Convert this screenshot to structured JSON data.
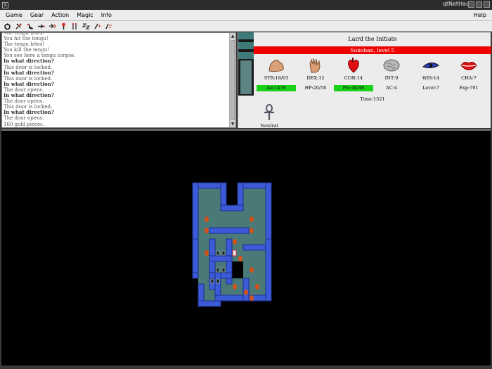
{
  "window": {
    "title": "qtNetHack",
    "close_glyph": "x"
  },
  "menu": {
    "items": [
      "Game",
      "Gear",
      "Action",
      "Magic",
      "Info"
    ],
    "help": "Help"
  },
  "toolbar": {
    "icons": [
      "again-icon",
      "get-icon",
      "kick-icon",
      "throw-icon",
      "fire-icon",
      "drop-icon",
      "eat-icon",
      "rest-icon",
      "cast-icon",
      "search-icon"
    ]
  },
  "messages": [
    {
      "text": "The tengu bites!",
      "bold": false
    },
    {
      "text": "You hit the tengu!",
      "bold": false
    },
    {
      "text": "The tengu bites!",
      "bold": false
    },
    {
      "text": "You kill the tengu!",
      "bold": false
    },
    {
      "text": "You see here a tengu corpse.",
      "bold": false
    },
    {
      "text": "In what direction?",
      "bold": true
    },
    {
      "text": "This door is locked.",
      "bold": false
    },
    {
      "text": "In what direction?",
      "bold": true
    },
    {
      "text": "This door is locked.",
      "bold": false
    },
    {
      "text": "In what direction?",
      "bold": true
    },
    {
      "text": "The door opens.",
      "bold": false
    },
    {
      "text": "In what direction?",
      "bold": true
    },
    {
      "text": "The door opens.",
      "bold": false
    },
    {
      "text": "This door is locked.",
      "bold": false
    },
    {
      "text": "In what direction?",
      "bold": true
    },
    {
      "text": "The door opens.",
      "bold": false
    },
    {
      "text": "160 gold pieces.",
      "bold": false
    }
  ],
  "status": {
    "name": "Laird the Initiate",
    "level_line": "Sokoban, level 5",
    "stats": [
      {
        "label": "STR:18/03",
        "icon": "bicep-icon"
      },
      {
        "label": "DEX:12",
        "icon": "hand-icon"
      },
      {
        "label": "CON:14",
        "icon": "heart-icon"
      },
      {
        "label": "INT:9",
        "icon": "brain-icon"
      },
      {
        "label": "WIS:14",
        "icon": "eye-icon"
      },
      {
        "label": "CHA:7",
        "icon": "lips-icon"
      }
    ],
    "values": [
      {
        "text": "Au:1470",
        "green": true
      },
      {
        "text": "HP:20/50",
        "green": false
      },
      {
        "text": "Pw:40/46",
        "green": true
      },
      {
        "text": "AC:4",
        "green": false
      },
      {
        "text": "Level:7",
        "green": false
      },
      {
        "text": "Exp:791",
        "green": false
      }
    ],
    "time": "Time:1521",
    "alignment": "Neutral"
  },
  "colors": {
    "floor": "#4a7a78",
    "wall": "#3b5bd9",
    "wall_dark": "#1f2f8a",
    "boulder": "#d2521a",
    "level_bar": "#ee0000",
    "hp_green": "#1ad11a"
  }
}
